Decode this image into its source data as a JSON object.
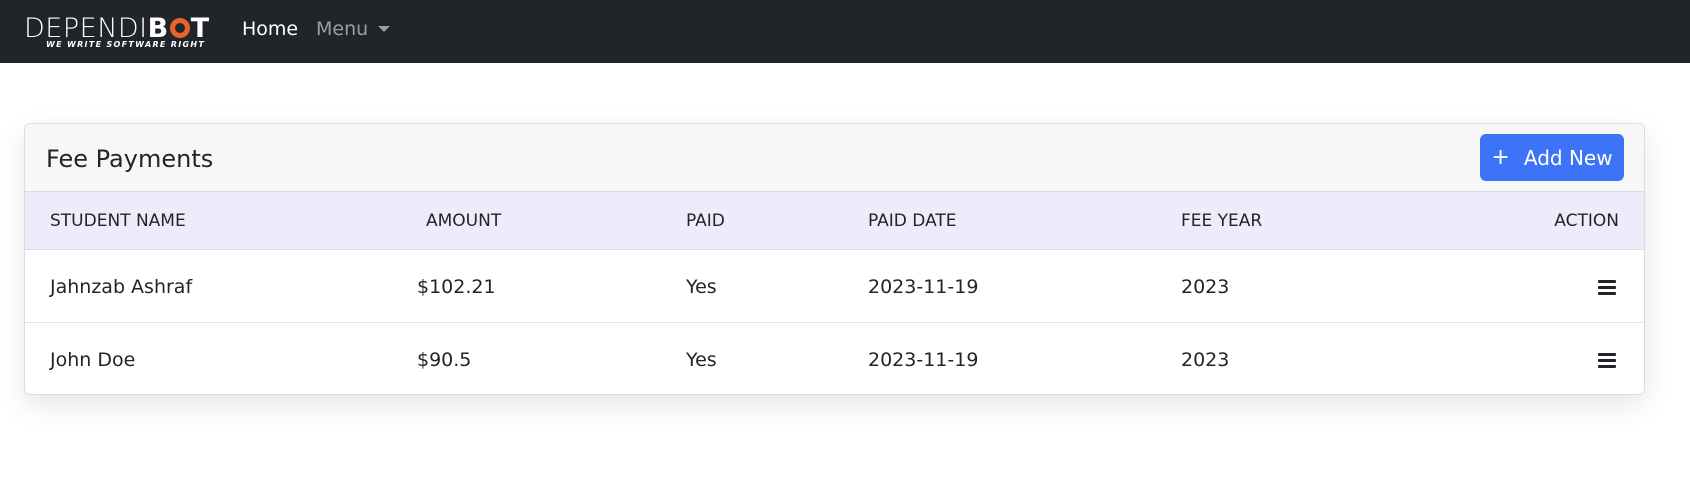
{
  "navbar": {
    "brand_part1": "DEPENDI",
    "brand_part2": "B",
    "brand_part3": "T",
    "brand_tagline": "WE WRITE SOFTWARE RIGHT",
    "home_label": "Home",
    "menu_label": "Menu",
    "menu_icon": "caret-down-icon"
  },
  "card": {
    "title": "Fee Payments",
    "add_button_label": "Add New",
    "add_button_icon": "plus-icon"
  },
  "table": {
    "headers": [
      "STUDENT NAME",
      "AMOUNT",
      "PAID",
      "PAID DATE",
      "FEE YEAR",
      "ACTION"
    ],
    "rows": [
      {
        "student_name": "Jahnzab Ashraf",
        "amount": "$102.21",
        "paid": "Yes",
        "paid_date": "2023-11-19",
        "fee_year": "2023",
        "action_icon": "menu-icon"
      },
      {
        "student_name": "John Doe",
        "amount": "$90.5",
        "paid": "Yes",
        "paid_date": "2023-11-19",
        "fee_year": "2023",
        "action_icon": "menu-icon"
      }
    ]
  },
  "colors": {
    "navbar_bg": "#212529",
    "brand_accent": "#e8622c",
    "primary_button": "#3d74f7",
    "table_header_bg": "#eeecfb"
  }
}
